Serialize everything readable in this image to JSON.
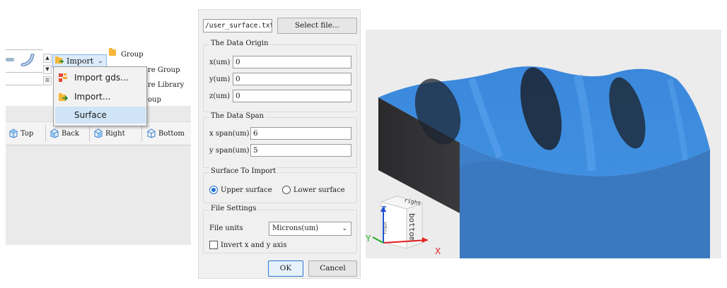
{
  "ribbon": {
    "import_label": "Import",
    "group_label": "Group",
    "partial_structure_group": "re Group",
    "partial_structure_library": "re Library",
    "partial_group": "oup"
  },
  "import_menu": {
    "items": [
      {
        "label": "Import gds..."
      },
      {
        "label": "Import..."
      },
      {
        "label": "Surface"
      }
    ],
    "selected": "Surface"
  },
  "view_toolbar": {
    "top": "Top",
    "back": "Back",
    "right": "Right",
    "bottom": "Bottom"
  },
  "dialog": {
    "file_path": "/user_surface.txt",
    "select_file": "Select file...",
    "data_origin": {
      "title": "The Data Origin",
      "x_label": "x(um)",
      "x_value": "0",
      "y_label": "y(um)",
      "y_value": "0",
      "z_label": "z(um)",
      "z_value": "0"
    },
    "data_span": {
      "title": "The Data Span",
      "x_label": "x span(um)",
      "x_value": "6",
      "y_label": "y span(um)",
      "y_value": "5"
    },
    "surface_to_import": {
      "title": "Surface To Import",
      "upper": "Upper surface",
      "lower": "Lower surface",
      "selected": "upper"
    },
    "file_settings": {
      "title": "File Settings",
      "units_label": "File units",
      "units_value": "Microns(um)",
      "invert_label": "Invert x and y axis",
      "invert_checked": false
    },
    "ok": "OK",
    "cancel": "Cancel"
  },
  "viewport": {
    "cube_labels": {
      "right": "right",
      "bottom": "bottom",
      "front": "front"
    },
    "axes": {
      "x": "X",
      "y": "Y",
      "z": "Z"
    },
    "colors": {
      "surface": "#3a86d8",
      "side_dark": "#1f1f22",
      "front_face": "#3d7fc9",
      "background": "#ececec",
      "x_axis": "#e02020",
      "y_axis": "#22b022",
      "z_axis": "#1e4fd0"
    }
  }
}
